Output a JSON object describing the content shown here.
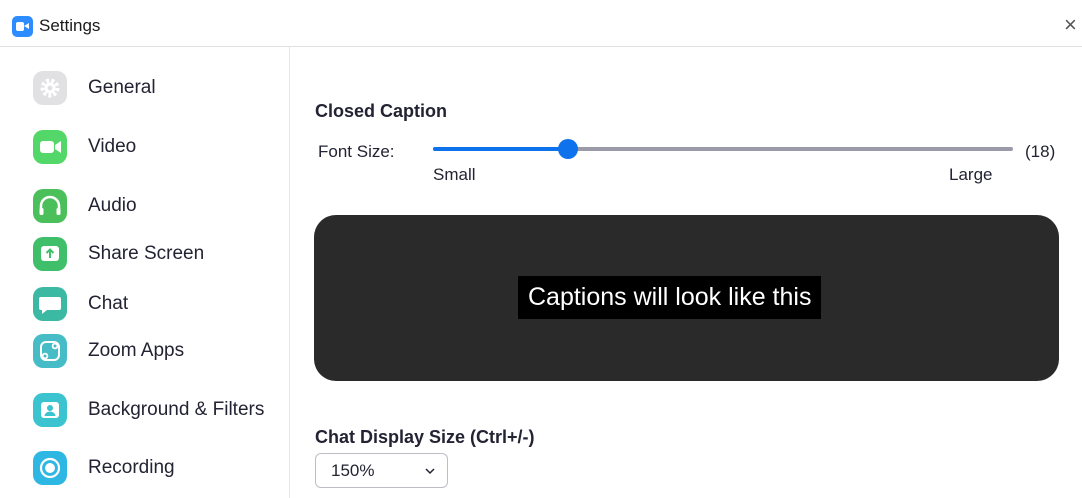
{
  "window": {
    "title": "Settings",
    "close_glyph": "×",
    "app_icon": "zoom-camera-icon"
  },
  "sidebar": {
    "items": [
      {
        "label": "General",
        "icon": "gear-icon",
        "color": "#e1e1e4"
      },
      {
        "label": "Video",
        "icon": "video-camera-icon",
        "color": "#53d768"
      },
      {
        "label": "Audio",
        "icon": "headphones-icon",
        "color": "#4bc05a"
      },
      {
        "label": "Share Screen",
        "icon": "share-screen-icon",
        "color": "#3fbf6a"
      },
      {
        "label": "Chat",
        "icon": "chat-bubble-icon",
        "color": "#3cb9a3"
      },
      {
        "label": "Zoom Apps",
        "icon": "apps-icon",
        "color": "#45bcc6"
      },
      {
        "label": "Background & Filters",
        "icon": "background-icon",
        "color": "#3bc3cf"
      },
      {
        "label": "Recording",
        "icon": "record-icon",
        "color": "#2fb7e3"
      }
    ]
  },
  "closed_caption": {
    "title": "Closed Caption",
    "font_size_label": "Font Size:",
    "value_display": "(18)",
    "min_label": "Small",
    "max_label": "Large",
    "fraction": 0.233,
    "accent_color": "#0e72ed",
    "preview_text": "Captions will look like this"
  },
  "chat_display": {
    "title": "Chat Display Size (Ctrl+/-)",
    "selected": "150%",
    "chevron_icon": "chevron-down-icon"
  }
}
